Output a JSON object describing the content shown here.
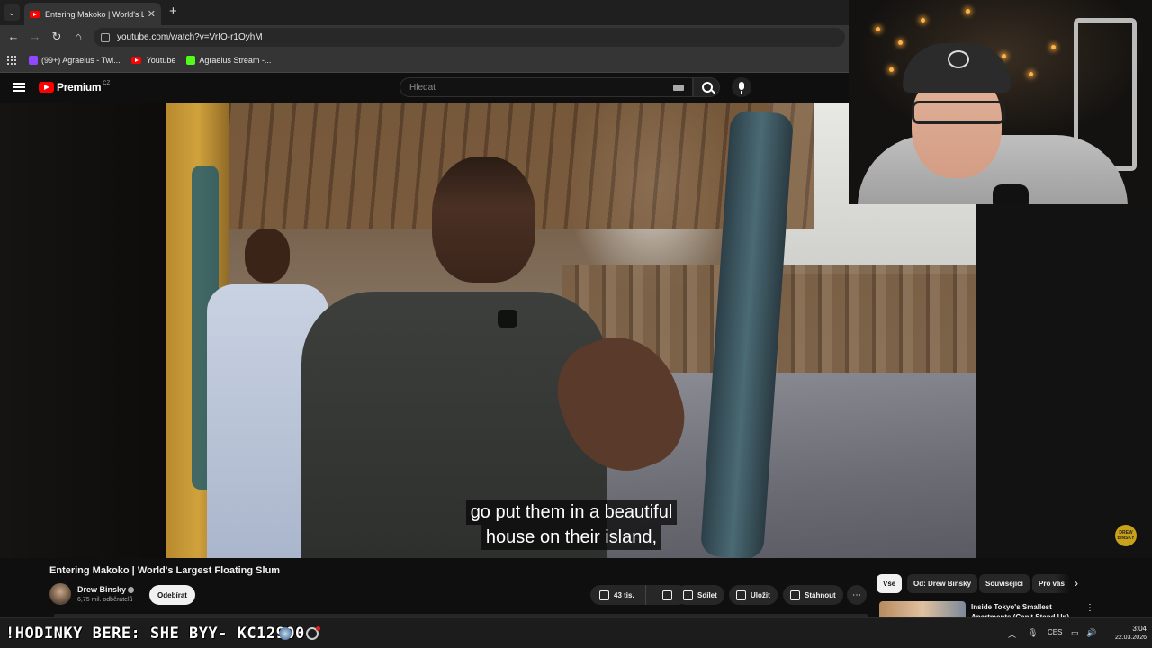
{
  "browser": {
    "tab_title": "Entering Makoko | World's Larg",
    "tab_close": "✕",
    "new_tab": "+",
    "url": "youtube.com/watch?v=VrIO-r1OyhM",
    "bookmarks": [
      {
        "label": "(99+) Agraelus - Twi...",
        "color": "#9146ff"
      },
      {
        "label": "Youtube",
        "color": "#ff0000"
      },
      {
        "label": "Agraelus Stream -...",
        "color": "#53fc18"
      }
    ]
  },
  "youtube": {
    "logo_text": "Premium",
    "logo_region": "CZ",
    "search_placeholder": "Hledat"
  },
  "video": {
    "caption_lines": [
      "go put them in a beautiful",
      "house on their island,"
    ],
    "watermark": "DREW BINSKY",
    "title": "Entering Makoko | World's Largest Floating Slum"
  },
  "channel": {
    "name": "Drew Binsky",
    "subscribers": "6,75 mil. odběratelů",
    "subscribe_label": "Odebírat"
  },
  "actions": {
    "likes": "43 tis.",
    "share": "Sdílet",
    "save": "Uložit",
    "download": "Stáhnout",
    "more": "⋯"
  },
  "sidebar": {
    "chips": [
      "Vše",
      "Od: Drew Binsky",
      "Související",
      "Pro vás"
    ],
    "recommended_title": "Inside Tokyo's Smallest Apartments (Can't Stand Up)"
  },
  "taskbar": {
    "overlay_text": "!HODINKY BERE: SHE  BYY- KC12900",
    "language": "CES",
    "time": "3:04",
    "date": "22.03.2026"
  },
  "colors": {
    "accent": "#ff0000",
    "background": "#0f0f0f"
  }
}
